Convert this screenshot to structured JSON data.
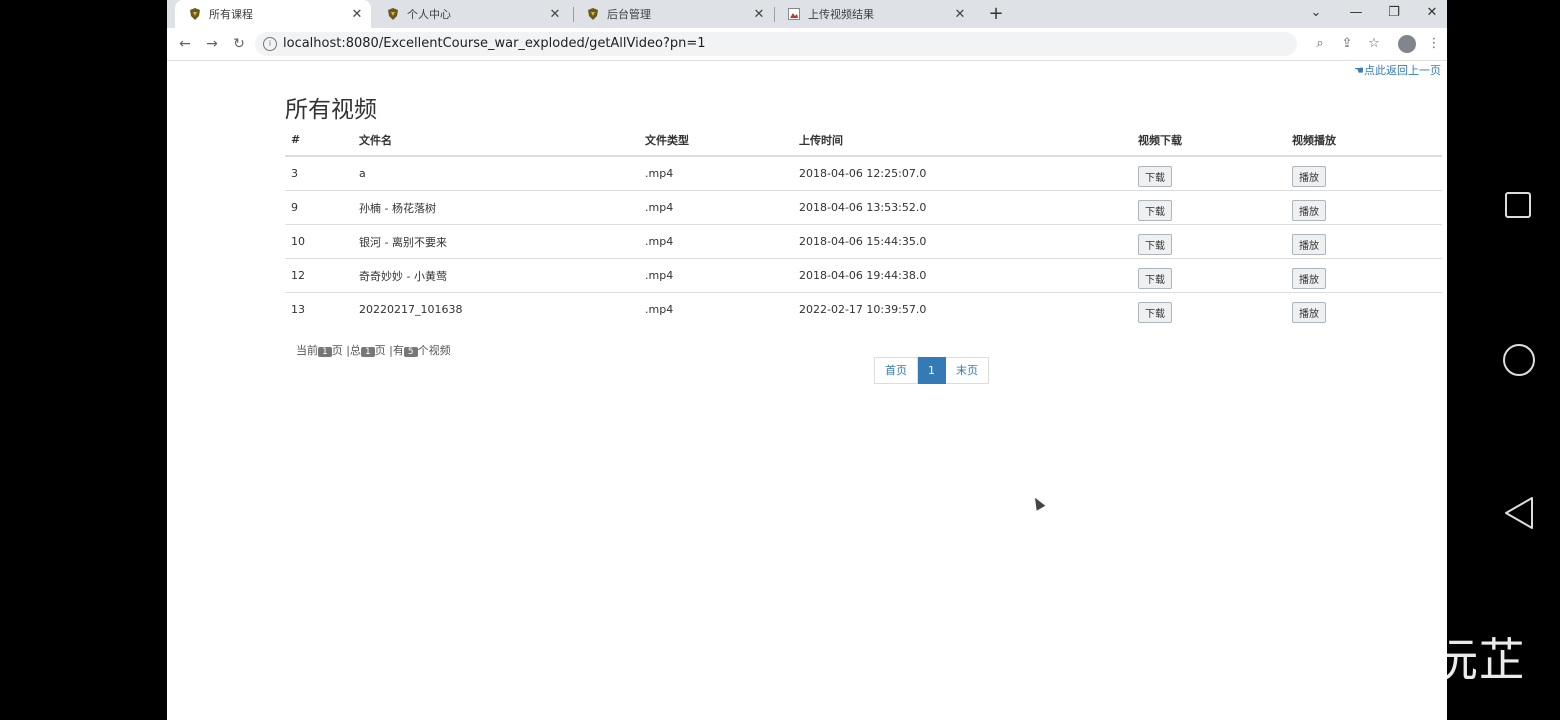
{
  "browser": {
    "tabs": [
      {
        "title": "所有课程",
        "active": true
      },
      {
        "title": "个人中心",
        "active": false
      },
      {
        "title": "后台管理",
        "active": false
      },
      {
        "title": "上传视频结果",
        "active": false
      }
    ],
    "new_tab": "+",
    "window_controls": {
      "dropdown": "⌄",
      "minimize": "—",
      "maximize": "❐",
      "close": "✕"
    },
    "url": "localhost:8080/ExcellentCourse_war_exploded/getAllVideo?pn=1"
  },
  "page": {
    "back_link": "点此返回上一页",
    "title": "所有视频",
    "table": {
      "headers": [
        "#",
        "文件名",
        "文件类型",
        "上传时间",
        "视频下载",
        "视频播放"
      ],
      "rows": [
        {
          "id": "3",
          "name": "a",
          "type": ".mp4",
          "time": "2018-04-06 12:25:07.0",
          "download": "下载",
          "play": "播放"
        },
        {
          "id": "9",
          "name": "孙楠 - 杨花落树",
          "type": ".mp4",
          "time": "2018-04-06 13:53:52.0",
          "download": "下载",
          "play": "播放"
        },
        {
          "id": "10",
          "name": "银河 - 离别不要来",
          "type": ".mp4",
          "time": "2018-04-06 15:44:35.0",
          "download": "下载",
          "play": "播放"
        },
        {
          "id": "12",
          "name": "奇奇妙妙 - 小黄莺",
          "type": ".mp4",
          "time": "2018-04-06 19:44:38.0",
          "download": "下载",
          "play": "播放"
        },
        {
          "id": "13",
          "name": "20220217_101638",
          "type": ".mp4",
          "time": "2022-02-17 10:39:57.0",
          "download": "下载",
          "play": "播放"
        }
      ]
    },
    "page_info": {
      "t1": "当前",
      "current": "1",
      "t2": "页 |总",
      "total_pages": "1",
      "t3": "页 |有",
      "total_videos": "5",
      "t4": "个视频"
    },
    "pagination": {
      "first": "首页",
      "current": "1",
      "last": "末页"
    }
  },
  "watermark": "知乎 @小沅芷"
}
